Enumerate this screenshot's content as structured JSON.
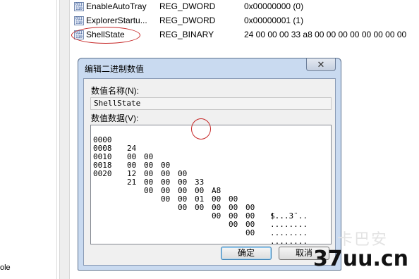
{
  "left_pane": {
    "fragment_text": "ole"
  },
  "registry_values": [
    {
      "name": "EnableAutoTray",
      "type": "REG_DWORD",
      "data": "0x00000000 (0)"
    },
    {
      "name": "ExplorerStartu...",
      "type": "REG_DWORD",
      "data": "0x00000001 (1)"
    },
    {
      "name": "ShellState",
      "type": "REG_BINARY",
      "data": "24 00 00 00 33 a8 00 00 00 00 00 00 00 00"
    }
  ],
  "icons": {
    "binary_value": "binary-registry-value-icon",
    "close": "close-icon"
  },
  "dialog": {
    "title": "编辑二进制数值",
    "close_glyph": "✕",
    "name_label": "数值名称(N):",
    "name_value": "ShellState",
    "data_label": "数值数据(V):",
    "hex_rows": [
      {
        "offset": "0000",
        "bytes": [
          "24",
          "00",
          "00",
          "00",
          "33",
          "A8",
          "00",
          "00"
        ],
        "ascii": "$...3¨.."
      },
      {
        "offset": "0008",
        "bytes": [
          "00",
          "00",
          "00",
          "00",
          "00",
          "00",
          "00",
          "00"
        ],
        "ascii": "........"
      },
      {
        "offset": "0010",
        "bytes": [
          "00",
          "00",
          "00",
          "00",
          "01",
          "00",
          "00",
          "00"
        ],
        "ascii": "........"
      },
      {
        "offset": "0018",
        "bytes": [
          "12",
          "00",
          "00",
          "00",
          "00",
          "00",
          "00",
          "00"
        ],
        "ascii": "........"
      },
      {
        "offset": "0020",
        "bytes": [
          "21",
          "00",
          "00",
          "00"
        ],
        "ascii": "!..."
      }
    ],
    "ok_label": "确定",
    "cancel_label": "取消"
  },
  "watermark": {
    "faint_text": "卡巴安",
    "brand_text": "37uu.cn"
  },
  "colors": {
    "annotation_red": "#c62828",
    "dialog_frame": "#c9daf0",
    "client_bg": "#f0f0f0"
  }
}
